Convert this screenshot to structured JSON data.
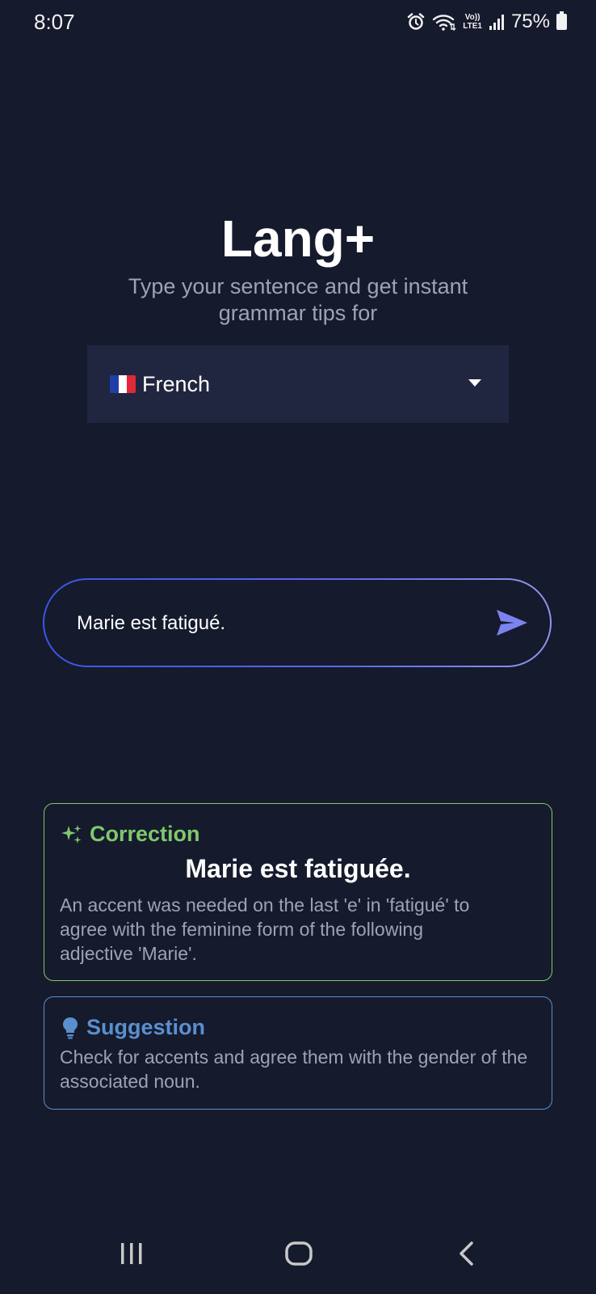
{
  "status_bar": {
    "time": "8:07",
    "network_label": "Vo))\nLTE1",
    "battery_percent": "75%",
    "icons": [
      "alarm-icon",
      "wifi-icon",
      "volte-icon",
      "signal-icon",
      "battery-icon"
    ]
  },
  "header": {
    "title": "Lang+",
    "subtitle": "Type your sentence and get instant grammar tips for"
  },
  "language_select": {
    "flag_icon": "france-flag-icon",
    "selected": "French",
    "arrow_icon": "dropdown-arrow-icon"
  },
  "sentence_input": {
    "value": "Marie est fatigué.",
    "send_icon": "send-icon"
  },
  "correction": {
    "icon": "sparkles-icon",
    "title": "Correction",
    "sentence": "Marie est fatiguée.",
    "explanation": "An accent was needed on the last 'e' in 'fatigué' to agree with the feminine form of the following adjective 'Marie'."
  },
  "suggestion": {
    "icon": "lightbulb-icon",
    "title": "Suggestion",
    "text": "Check for accents and agree them with the gender of the associated noun."
  },
  "nav_bar": {
    "icons": [
      "recent-apps-icon",
      "home-icon",
      "back-icon"
    ]
  },
  "colors": {
    "background": "#151a2c",
    "dropdown_bg": "#212640",
    "correction_accent": "#7fc86c",
    "suggestion_accent": "#5a8fcf",
    "input_border_start": "#3c54e6",
    "input_border_end": "#9095f0",
    "send_icon": "#7b83ee",
    "muted_text": "#9ea3b3"
  }
}
